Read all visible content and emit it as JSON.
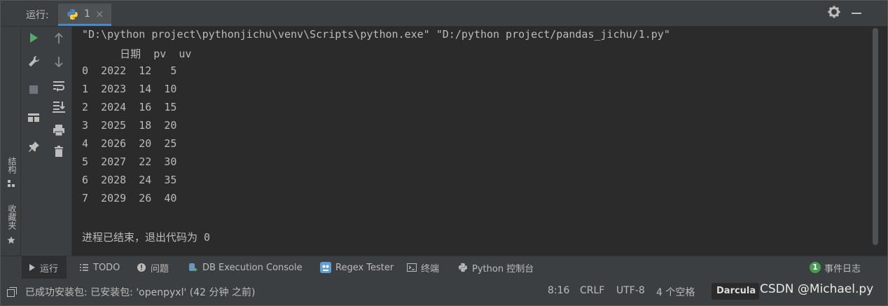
{
  "header": {
    "run_label": "运行:",
    "tab_name": "1",
    "tab_close": "×"
  },
  "left_strip": {
    "structure_label": "结构",
    "favorites_label": "收藏夹"
  },
  "console": {
    "lines": [
      "\"D:\\python project\\pythonjichu\\venv\\Scripts\\python.exe\" \"D:/python project/pandas_jichu/1.py\"",
      "      日期  pv  uv",
      "0  2022  12   5",
      "1  2023  14  10",
      "2  2024  16  15",
      "3  2025  18  20",
      "4  2026  20  25",
      "5  2027  22  30",
      "6  2028  24  35",
      "7  2029  26  40",
      "",
      "进程已结束，退出代码为 0"
    ]
  },
  "bottom_tabs": {
    "run": "运行",
    "todo": "TODO",
    "problems": "问题",
    "db_console": "DB Execution Console",
    "regex": "Regex Tester",
    "terminal": "终端",
    "python_console": "Python 控制台",
    "event_count": "1",
    "event_log": "事件日志"
  },
  "status": {
    "message": "已成功安装包: 已安装包: 'openpyxl' (42 分钟 之前)",
    "position": "8:16",
    "line_sep": "CRLF",
    "encoding": "UTF-8",
    "indent": "4 个空格",
    "theme": "Darcula",
    "watermark": "CSDN @Michael.py"
  },
  "colors": {
    "run_green": "#59a869",
    "accent_blue": "#4a88c7",
    "event_green": "#499c54"
  }
}
